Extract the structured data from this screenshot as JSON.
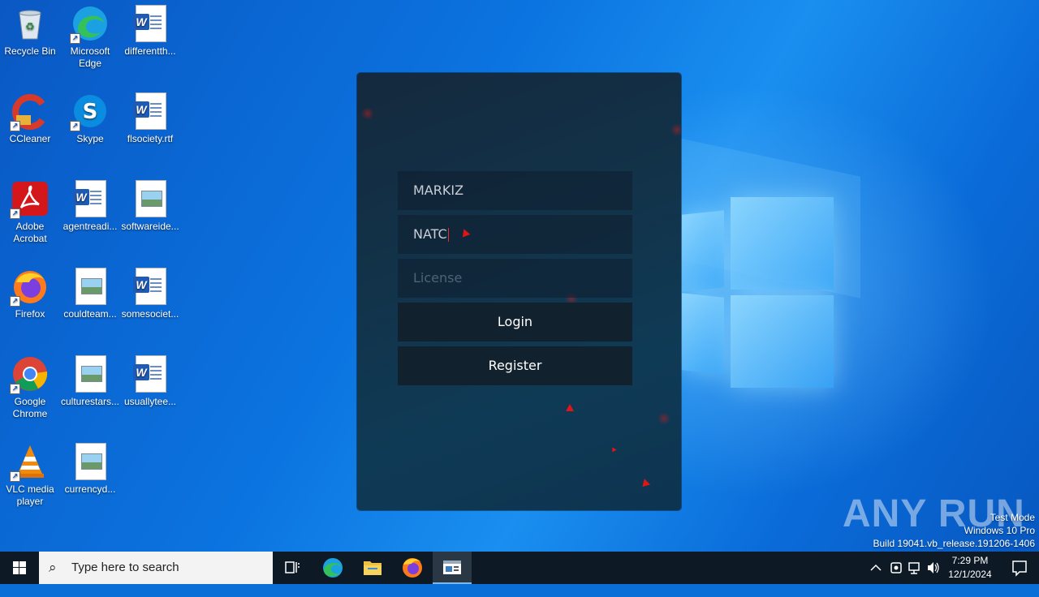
{
  "desktop": {
    "icons": [
      {
        "label": "Recycle Bin",
        "icon": "recycle-bin-icon"
      },
      {
        "label": "Microsoft Edge",
        "icon": "edge-icon"
      },
      {
        "label": "differentth...",
        "icon": "word-doc-icon"
      },
      {
        "label": "CCleaner",
        "icon": "ccleaner-icon"
      },
      {
        "label": "Skype",
        "icon": "skype-icon"
      },
      {
        "label": "flsociety.rtf",
        "icon": "word-doc-icon"
      },
      {
        "label": "Adobe Acrobat",
        "icon": "acrobat-icon"
      },
      {
        "label": "agentreadi...",
        "icon": "word-doc-icon"
      },
      {
        "label": "softwareide...",
        "icon": "image-file-icon"
      },
      {
        "label": "Firefox",
        "icon": "firefox-icon"
      },
      {
        "label": "couldteam...",
        "icon": "image-file-icon"
      },
      {
        "label": "somesociet...",
        "icon": "word-doc-icon"
      },
      {
        "label": "Google Chrome",
        "icon": "chrome-icon"
      },
      {
        "label": "culturestars...",
        "icon": "image-file-icon"
      },
      {
        "label": "usuallytee...",
        "icon": "word-doc-icon"
      },
      {
        "label": "VLC media player",
        "icon": "vlc-icon"
      },
      {
        "label": "currencyd...",
        "icon": "image-file-icon"
      }
    ]
  },
  "dialog": {
    "username_value": "MARKIZ",
    "password_value": "NATC",
    "license_placeholder": "License",
    "login_label": "Login",
    "register_label": "Register"
  },
  "watermark": {
    "brand": "ANY RUN",
    "mode": "Test Mode",
    "edition": "Windows 10 Pro",
    "build": "Build 19041.vb_release.191206-1406"
  },
  "taskbar": {
    "search_placeholder": "Type here to search",
    "time": "7:29 PM",
    "date": "12/1/2024"
  }
}
